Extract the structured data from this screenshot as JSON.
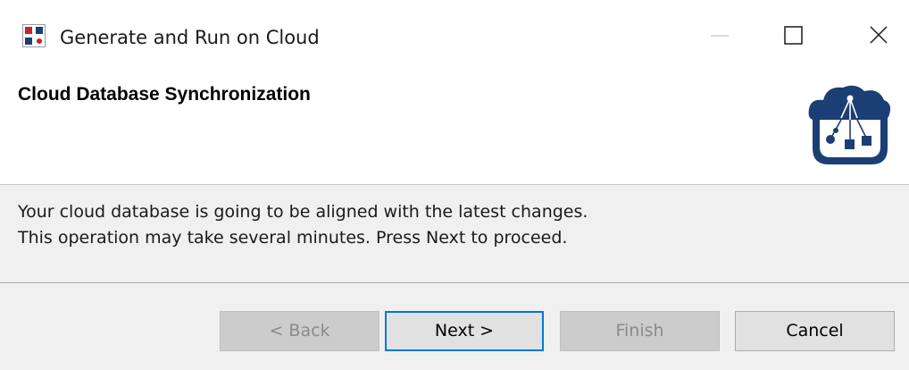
{
  "window": {
    "title": "Generate and Run on Cloud",
    "app_icon": "app-logo-icon",
    "controls": {
      "minimize_icon": "minimize-icon",
      "maximize_icon": "maximize-icon",
      "close_icon": "close-icon"
    }
  },
  "header": {
    "title": "Cloud Database Synchronization",
    "icon": "cloud-database-icon"
  },
  "content": {
    "line1": "Your cloud database is going to be aligned with the latest changes.",
    "line2": "This operation may take several minutes. Press Next to proceed."
  },
  "buttons": {
    "back": {
      "label": "< Back",
      "enabled": false
    },
    "next": {
      "label": "Next >",
      "enabled": true,
      "focused": true
    },
    "finish": {
      "label": "Finish",
      "enabled": false
    },
    "cancel": {
      "label": "Cancel",
      "enabled": true
    }
  },
  "colors": {
    "focus_border": "#0078d7",
    "icon_navy": "#1b3f74",
    "panel_bg": "#f0f0f0",
    "disabled_bg": "#cccccc",
    "logo_red": "#c8222a",
    "logo_blue": "#1b3f74"
  }
}
